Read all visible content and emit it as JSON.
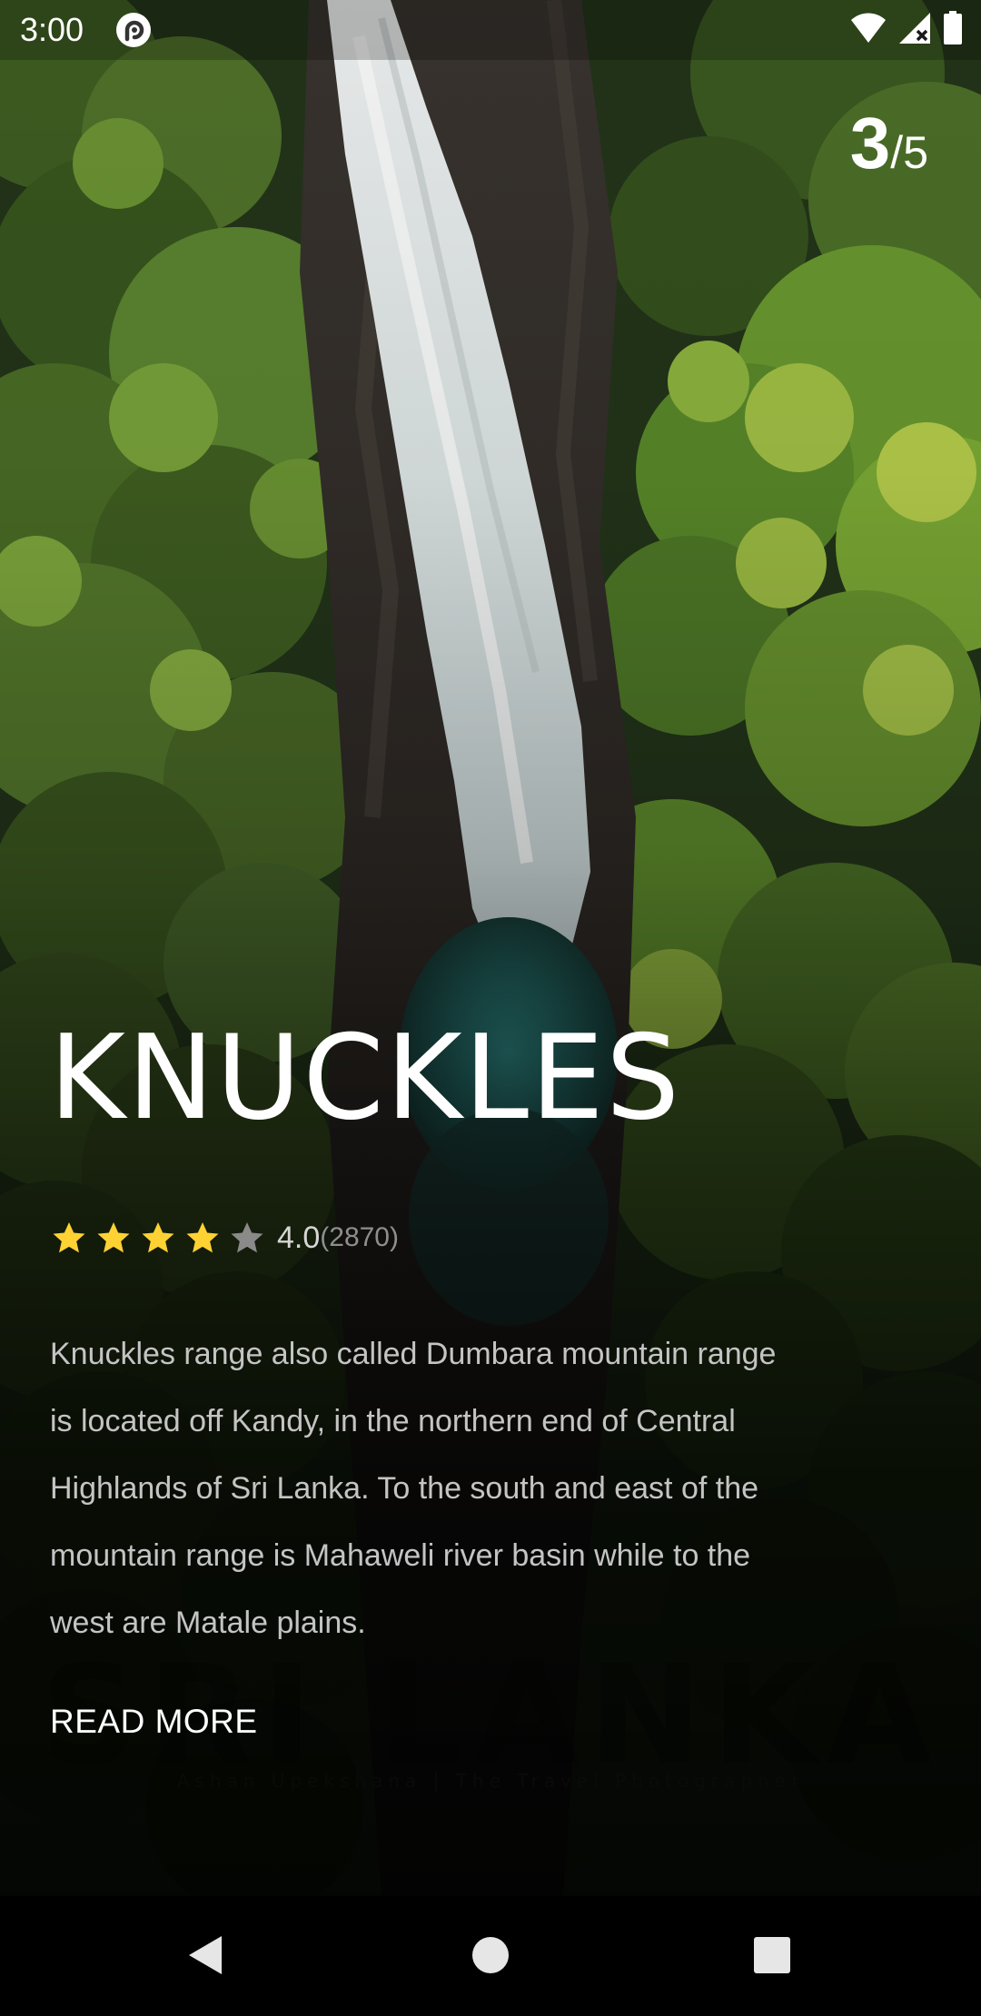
{
  "status_bar": {
    "time": "3:00",
    "app_icon": "pocket-casts-icon",
    "icons": [
      "wifi-icon",
      "signal-icon",
      "battery-icon"
    ]
  },
  "pager": {
    "current": "3",
    "separator": "/",
    "total": "5"
  },
  "place": {
    "title": "KNUCKLES",
    "rating": {
      "stars_filled": 4,
      "stars_total": 5,
      "value": "4.0",
      "count": "(2870)"
    },
    "description": "Knuckles range also called Dumbara mountain range is located off Kandy, in the northern end of Central Highlands of Sri Lanka. To the south and east of the mountain range is Mahaweli river basin while to the west are Matale plains.",
    "read_more": "READ MORE"
  },
  "background": {
    "watermark_title": "SRI LANKA",
    "watermark_credit": "Ashan Upekshana | The Travel Photographer"
  },
  "navigation": {
    "icons": [
      "back-icon",
      "home-icon",
      "recents-icon"
    ]
  },
  "colors": {
    "star_filled": "#FFD234",
    "star_empty": "#8A8A8A",
    "text_primary": "#FFFFFF",
    "text_secondary": "#C4C4C4"
  }
}
